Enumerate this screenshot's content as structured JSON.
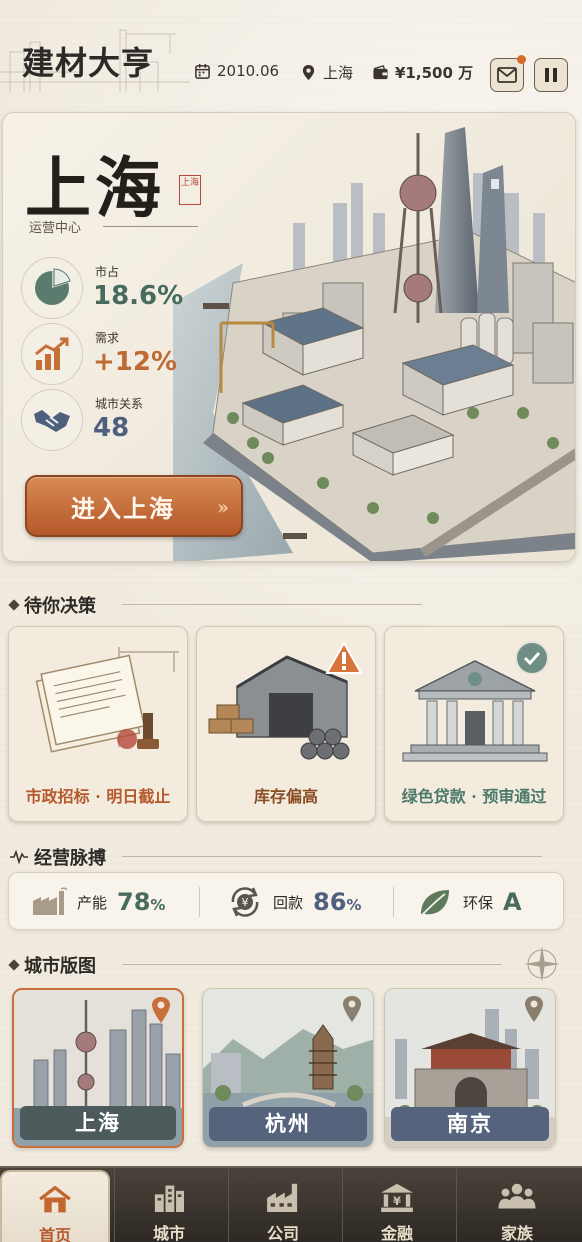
{
  "app": {
    "title": "建材大亨"
  },
  "header": {
    "date": "2010.06",
    "location": "上海",
    "funds": "¥1,500 万"
  },
  "hero": {
    "city": "上海",
    "seal": "上海",
    "subtitle": "运营中心",
    "metrics": [
      {
        "icon": "pie-chart-icon",
        "label": "市占",
        "value": "18.6%",
        "color": "#476b5e"
      },
      {
        "icon": "trend-up-icon",
        "label": "需求",
        "value": "+12%",
        "color": "#bf6a34"
      },
      {
        "icon": "handshake-icon",
        "label": "城市关系",
        "value": "48",
        "color": "#4f5f7e"
      }
    ],
    "enter_button": "进入上海"
  },
  "decisions": {
    "title": "待你决策",
    "cards": [
      {
        "label": "市政招标 · 明日截止",
        "color": "#b5582b",
        "icon": "contract-icon"
      },
      {
        "label": "库存偏高",
        "color": "#8a4d24",
        "icon": "warehouse-icon",
        "badge": "warning-icon"
      },
      {
        "label": "绿色贷款 · 预审通过",
        "color": "#4e7a6b",
        "icon": "bank-icon",
        "badge": "check-icon"
      }
    ]
  },
  "pulse": {
    "title": "经营脉搏",
    "items": [
      {
        "icon": "factory-icon",
        "label": "产能",
        "value": "78",
        "unit": "%",
        "color": "#476b5e"
      },
      {
        "icon": "cash-cycle-icon",
        "label": "回款",
        "value": "86",
        "unit": "%",
        "color": "#4f5f7e"
      },
      {
        "icon": "leaf-icon",
        "label": "环保",
        "value": "A",
        "unit": "",
        "color": "#476b5e"
      }
    ]
  },
  "citymap": {
    "title": "城市版图",
    "cities": [
      {
        "name": "上海",
        "active": true
      },
      {
        "name": "杭州",
        "active": false
      },
      {
        "name": "南京",
        "active": false
      }
    ]
  },
  "nav": {
    "items": [
      {
        "label": "首页",
        "icon": "home-icon",
        "active": true
      },
      {
        "label": "城市",
        "icon": "city-icon",
        "active": false
      },
      {
        "label": "公司",
        "icon": "company-icon",
        "active": false
      },
      {
        "label": "金融",
        "icon": "finance-icon",
        "active": false
      },
      {
        "label": "家族",
        "icon": "family-icon",
        "active": false
      }
    ]
  }
}
